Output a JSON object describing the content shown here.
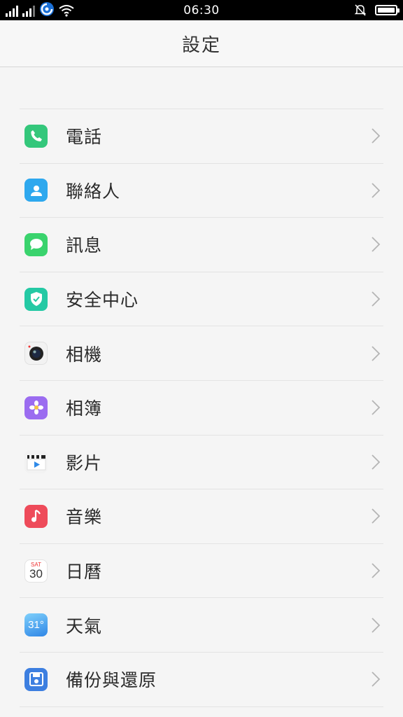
{
  "status": {
    "time": "06:30"
  },
  "header": {
    "title": "設定"
  },
  "items": [
    {
      "label": "電話",
      "icon": "phone-icon",
      "color": "#34c77b"
    },
    {
      "label": "聯絡人",
      "icon": "contacts-icon",
      "color": "#2ea8ee"
    },
    {
      "label": "訊息",
      "icon": "message-icon",
      "color": "#3ad36d"
    },
    {
      "label": "安全中心",
      "icon": "security-shield-icon",
      "color": "#24c9a4"
    },
    {
      "label": "相機",
      "icon": "camera-icon",
      "color": "#f2f2f2"
    },
    {
      "label": "相簿",
      "icon": "photos-flower-icon",
      "color": "#9b6cf0"
    },
    {
      "label": "影片",
      "icon": "video-clapper-icon",
      "color": "#f2f2f2"
    },
    {
      "label": "音樂",
      "icon": "music-note-icon",
      "color": "#ee4b5a"
    },
    {
      "label": "日曆",
      "icon": "calendar-icon",
      "color": "#ffffff",
      "weekday": "SAT",
      "day": "30"
    },
    {
      "label": "天氣",
      "icon": "weather-icon",
      "color": "#4aa8f0",
      "temp": "31°"
    },
    {
      "label": "備份與還原",
      "icon": "backup-floppy-icon",
      "color": "#3d7fe0"
    }
  ]
}
